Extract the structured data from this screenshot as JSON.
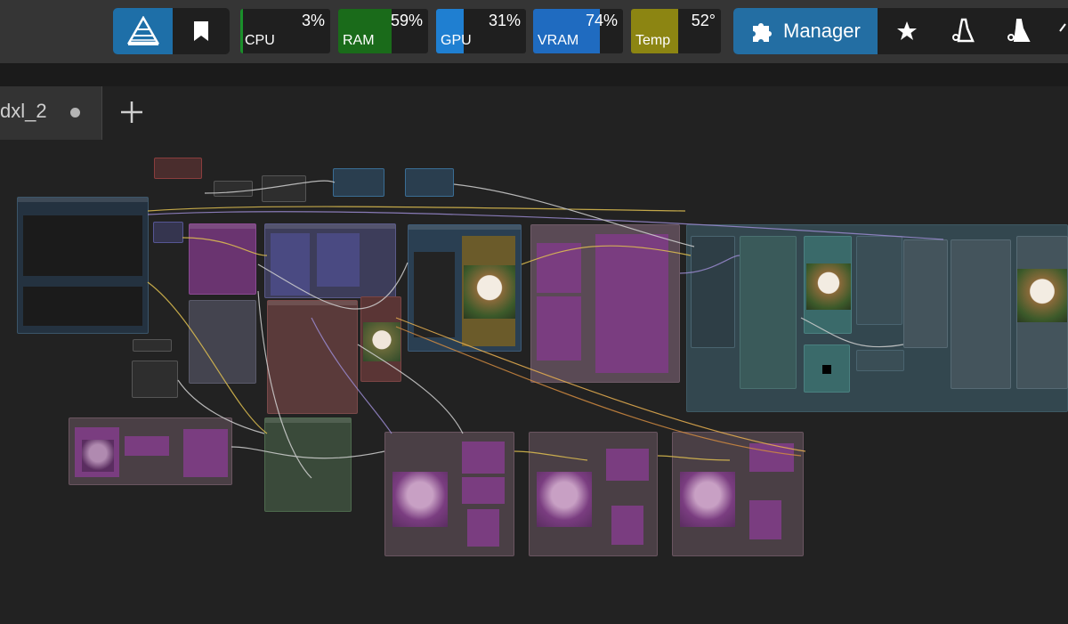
{
  "toolbar": {
    "bookmark_icon": "bookmark-icon",
    "logo_icon": "comfy-logo-icon"
  },
  "monitors": [
    {
      "key": "cpu",
      "label": "CPU",
      "value": "3%",
      "fraction": 0.03,
      "color": "#1a8f2a"
    },
    {
      "key": "ram",
      "label": "RAM",
      "value": "59%",
      "fraction": 0.59,
      "color": "#1a6b1a"
    },
    {
      "key": "gpu",
      "label": "GPU",
      "value": "31%",
      "fraction": 0.31,
      "color": "#1f7fd1"
    },
    {
      "key": "vram",
      "label": "VRAM",
      "value": "74%",
      "fraction": 0.74,
      "color": "#1f6bc0"
    },
    {
      "key": "temp",
      "label": "Temp",
      "value": "52°",
      "fraction": 0.52,
      "color": "#8c8512"
    }
  ],
  "manager": {
    "label": "Manager",
    "icons": [
      "puzzle-icon",
      "star-icon",
      "broom-icon",
      "broom-all-icon"
    ]
  },
  "tabs": [
    {
      "name": "dxl_2",
      "unsaved": true
    }
  ],
  "colors": {
    "accent_blue": "#236ea3",
    "canvas_bg": "#222222",
    "node_purple": "#7a3d80",
    "node_teal": "#3a5a66",
    "node_red": "#6a3a3a"
  }
}
